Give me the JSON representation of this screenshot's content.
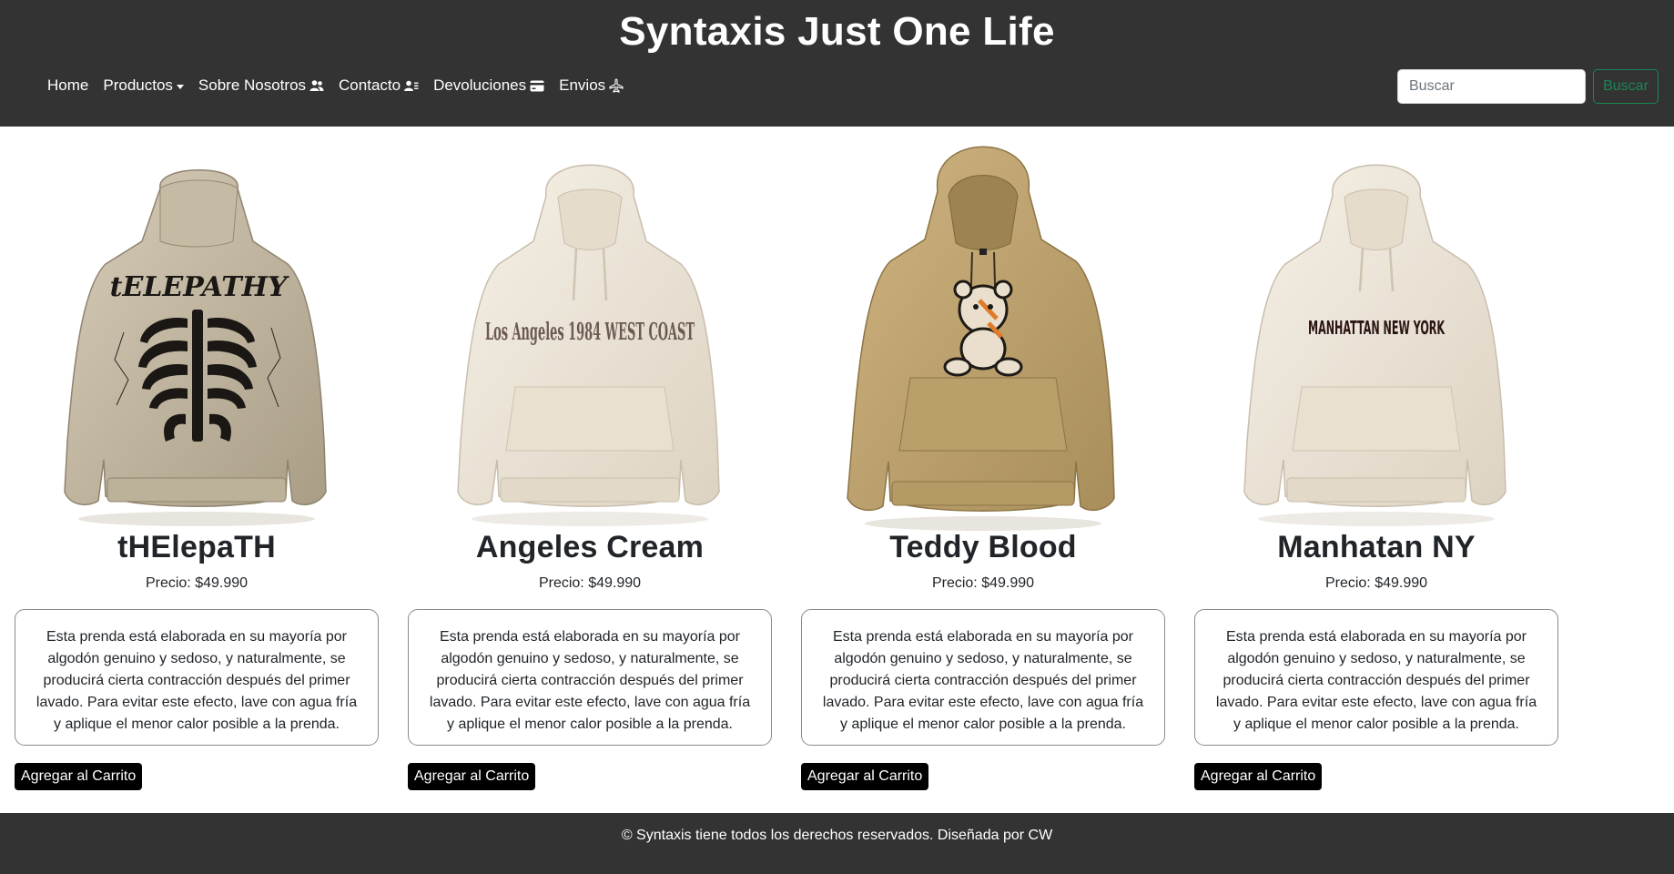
{
  "header": {
    "title": "Syntaxis Just One Life",
    "nav": [
      {
        "label": "Home",
        "icon": ""
      },
      {
        "label": "Productos",
        "icon": "caret-down-icon"
      },
      {
        "label": "Sobre Nosotros",
        "icon": "people-icon"
      },
      {
        "label": "Contacto",
        "icon": "contact-card-icon"
      },
      {
        "label": "Devoluciones",
        "icon": "credit-card-icon"
      },
      {
        "label": "Envios",
        "icon": "airplane-icon"
      }
    ],
    "search": {
      "placeholder": "Buscar",
      "button_label": "Buscar"
    }
  },
  "products": [
    {
      "name": "tHElepaTH",
      "price": "Precio: $49.990",
      "description": "Esta prenda está elaborada en su mayoría por algodón genuino y sedoso, y naturalmente, se producirá cierta contracción después del primer lavado. Para evitar este efecto, lave con agua fría y aplique el menor calor posible a la prenda.",
      "button_label": "Agregar al Carrito",
      "image_print": "tELEPATHY",
      "image": "hoodie-back-skeleton-print",
      "color": "#c9bea8"
    },
    {
      "name": "Angeles Cream",
      "price": "Precio: $49.990",
      "description": "Esta prenda está elaborada en su mayoría por algodón genuino y sedoso, y naturalmente, se producirá cierta contracción después del primer lavado. Para evitar este efecto, lave con agua fría y aplique el menor calor posible a la prenda.",
      "button_label": "Agregar al Carrito",
      "image_print": "Los Angeles 1984 WEST COAST",
      "image": "hoodie-front-los-angeles-print",
      "color": "#efe8dc"
    },
    {
      "name": "Teddy Blood",
      "price": "Precio: $49.990",
      "description": "Esta prenda está elaborada en su mayoría por algodón genuino y sedoso, y naturalmente, se producirá cierta contracción después del primer lavado. Para evitar este efecto, lave con agua fría y aplique el menor calor posible a la prenda.",
      "button_label": "Agregar al Carrito",
      "image_print": "",
      "image": "hoodie-front-teddy-bear-print",
      "color": "#c3a66f"
    },
    {
      "name": "Manhatan NY",
      "price": "Precio: $49.990",
      "description": "Esta prenda está elaborada en su mayoría por algodón genuino y sedoso, y naturalmente, se producirá cierta contracción después del primer lavado. Para evitar este efecto, lave con agua fría y aplique el menor calor posible a la prenda.",
      "button_label": "Agregar al Carrito",
      "image_print": "MANHATTAN NEW YORK",
      "image": "hoodie-front-manhattan-print",
      "color": "#efe8dc"
    }
  ],
  "footer": {
    "text": "© Syntaxis tiene todos los derechos reservados. Diseñada por CW"
  },
  "colors": {
    "header_bg": "#333333",
    "search_button": "#198754",
    "cart_button": "#000000"
  }
}
